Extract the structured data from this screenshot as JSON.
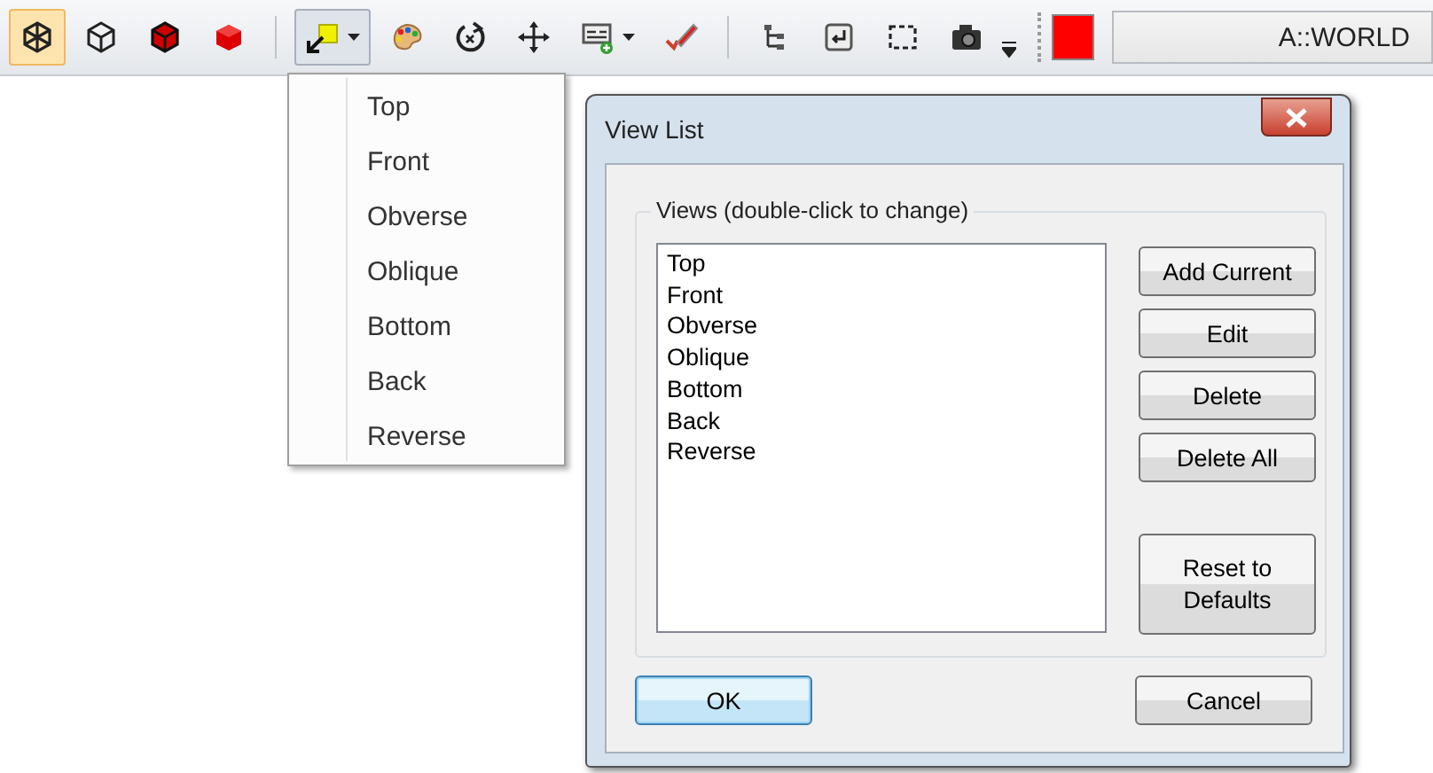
{
  "toolbar": {
    "groups": [
      [
        {
          "kind": "wireframe",
          "selected": true,
          "dropdown": false
        },
        {
          "kind": "outline-cube",
          "selected": false,
          "dropdown": false
        },
        {
          "kind": "edged-cube",
          "selected": false,
          "dropdown": false
        },
        {
          "kind": "solid-cube",
          "selected": false,
          "dropdown": false
        }
      ],
      [
        {
          "kind": "view-cube",
          "selected": true,
          "dropdown": true
        },
        {
          "kind": "palette",
          "selected": false,
          "dropdown": false
        },
        {
          "kind": "rotate",
          "selected": false,
          "dropdown": false
        },
        {
          "kind": "pan",
          "selected": false,
          "dropdown": false
        },
        {
          "kind": "display",
          "selected": false,
          "dropdown": true
        },
        {
          "kind": "brush",
          "selected": false,
          "dropdown": false
        }
      ],
      [
        {
          "kind": "tree",
          "selected": false,
          "dropdown": false
        },
        {
          "kind": "enter",
          "selected": false,
          "dropdown": false
        },
        {
          "kind": "select-box",
          "selected": false,
          "dropdown": false
        },
        {
          "kind": "camera",
          "selected": false,
          "dropdown": false
        }
      ]
    ],
    "color_swatch": {
      "color": "#ff0000"
    },
    "coordinate_field": {
      "value": "A::WORLD"
    }
  },
  "view_menu": {
    "items": [
      "Top",
      "Front",
      "Obverse",
      "Oblique",
      "Bottom",
      "Back",
      "Reverse"
    ]
  },
  "dialog": {
    "title": "View List",
    "group_label": "Views (double-click to change)",
    "views": [
      "Top",
      "Front",
      "Obverse",
      "Oblique",
      "Bottom",
      "Back",
      "Reverse"
    ],
    "side_buttons": [
      "Add Current",
      "Edit",
      "Delete",
      "Delete All"
    ],
    "reset_button": "Reset to Defaults",
    "footer_buttons": [
      {
        "label": "OK",
        "default": true
      },
      {
        "label": "Cancel",
        "default": false
      }
    ]
  }
}
